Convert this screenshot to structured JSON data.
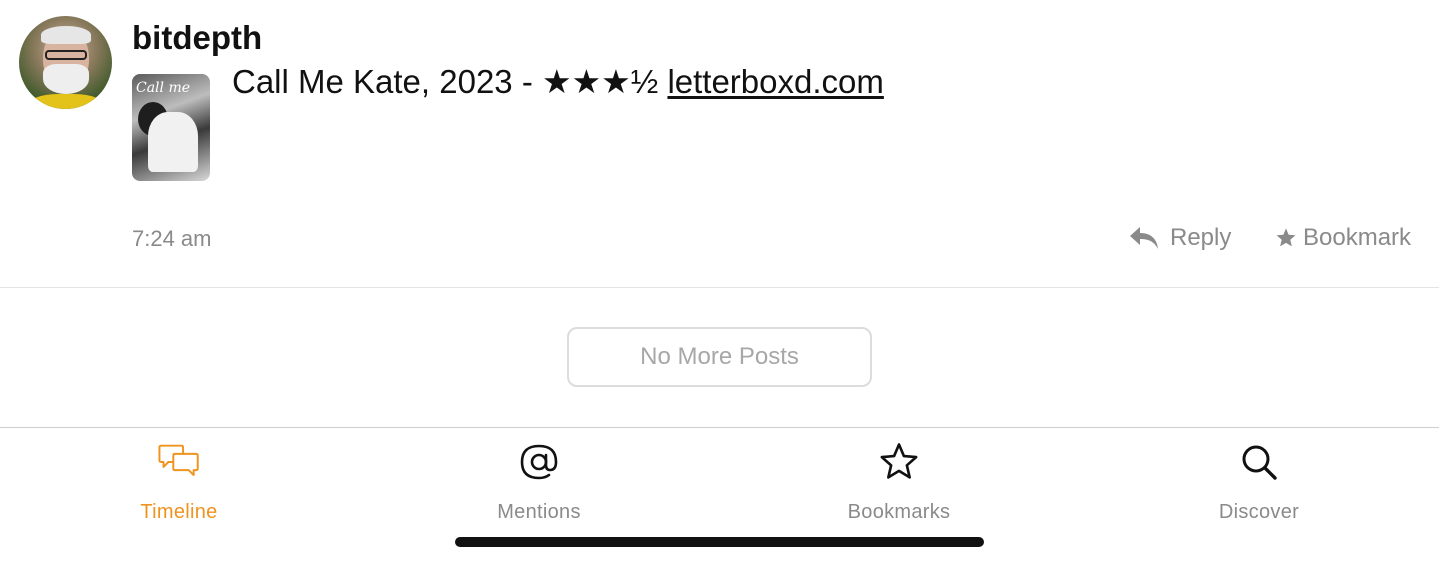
{
  "post": {
    "username": "bitdepth",
    "text_prefix": "Call Me Kate, 2023 - ★★★½ ",
    "link_text": "letterboxd.com",
    "time": "7:24 am",
    "thumbnail_caption": "Call me",
    "actions": {
      "reply_label": "Reply",
      "bookmark_label": "Bookmark"
    }
  },
  "list_footer": {
    "no_more_label": "No More Posts"
  },
  "tabbar": {
    "tabs": [
      {
        "label": "Timeline",
        "icon": "speech-bubbles-icon",
        "active": true
      },
      {
        "label": "Mentions",
        "icon": "at-sign-icon",
        "active": false
      },
      {
        "label": "Bookmarks",
        "icon": "star-outline-icon",
        "active": false
      },
      {
        "label": "Discover",
        "icon": "magnifier-icon",
        "active": false
      }
    ]
  },
  "colors": {
    "accent": "#f0931e",
    "muted_text": "#8a8a8a",
    "primary_text": "#111111",
    "button_border": "#dcdcdc"
  }
}
